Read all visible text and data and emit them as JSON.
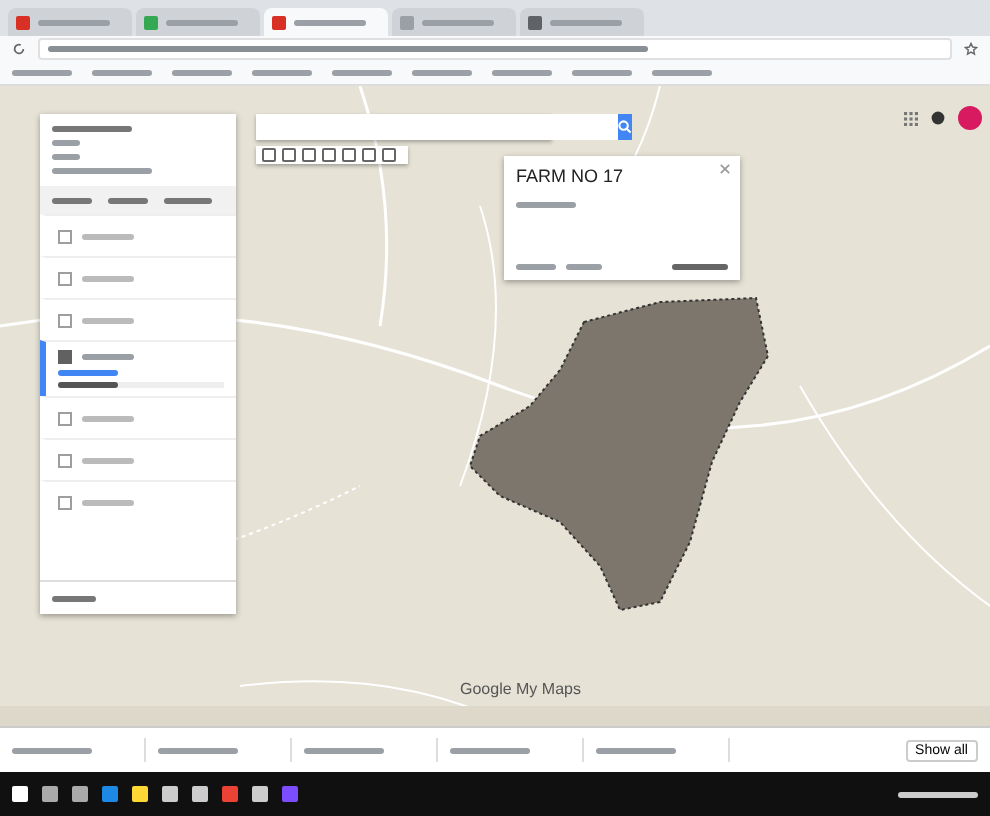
{
  "browser": {
    "tabs": [
      {
        "selected": false,
        "color": "#d93025"
      },
      {
        "selected": false,
        "color": "#34a853"
      },
      {
        "selected": true,
        "color": "#d93025"
      },
      {
        "selected": false,
        "color": "#9aa0a6"
      },
      {
        "selected": false,
        "color": "#5f6368"
      }
    ]
  },
  "layers": [
    {
      "checked": false,
      "selected": false
    },
    {
      "checked": false,
      "selected": false
    },
    {
      "checked": false,
      "selected": false
    },
    {
      "checked": true,
      "selected": true
    },
    {
      "checked": false,
      "selected": false
    },
    {
      "checked": false,
      "selected": false
    },
    {
      "checked": false,
      "selected": false
    }
  ],
  "popup": {
    "title": "FARM NO 17"
  },
  "map": {
    "footer": "Google My Maps"
  },
  "downloads": {
    "button": "Show all"
  }
}
